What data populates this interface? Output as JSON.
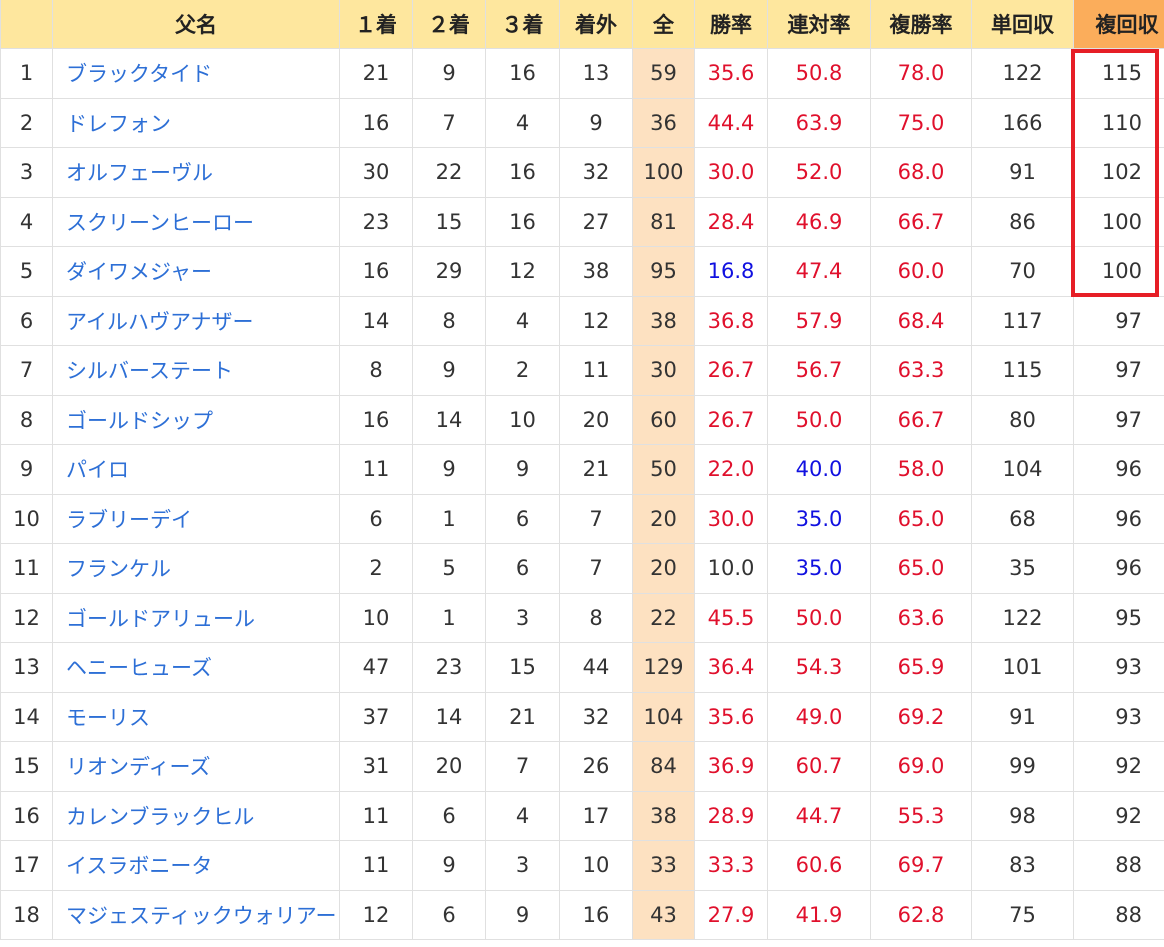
{
  "table": {
    "headers": {
      "rank": "",
      "name": "父名",
      "first": "１着",
      "second": "２着",
      "third": "３着",
      "out": "着外",
      "total": "全",
      "win_rate": "勝率",
      "quinella_rate": "連対率",
      "show_rate": "複勝率",
      "win_return": "単回収",
      "show_return": "複回収"
    },
    "rows": [
      {
        "rank": "1",
        "name": "ブラックタイド",
        "first": "21",
        "second": "9",
        "third": "16",
        "out": "13",
        "total": "59",
        "win_rate": "35.6",
        "quinella_rate": "50.8",
        "show_rate": "78.0",
        "win_return": "122",
        "show_return": "115"
      },
      {
        "rank": "2",
        "name": "ドレフォン",
        "first": "16",
        "second": "7",
        "third": "4",
        "out": "9",
        "total": "36",
        "win_rate": "44.4",
        "quinella_rate": "63.9",
        "show_rate": "75.0",
        "win_return": "166",
        "show_return": "110"
      },
      {
        "rank": "3",
        "name": "オルフェーヴル",
        "first": "30",
        "second": "22",
        "third": "16",
        "out": "32",
        "total": "100",
        "win_rate": "30.0",
        "quinella_rate": "52.0",
        "show_rate": "68.0",
        "win_return": "91",
        "show_return": "102"
      },
      {
        "rank": "4",
        "name": "スクリーンヒーロー",
        "first": "23",
        "second": "15",
        "third": "16",
        "out": "27",
        "total": "81",
        "win_rate": "28.4",
        "quinella_rate": "46.9",
        "show_rate": "66.7",
        "win_return": "86",
        "show_return": "100"
      },
      {
        "rank": "5",
        "name": "ダイワメジャー",
        "first": "16",
        "second": "29",
        "third": "12",
        "out": "38",
        "total": "95",
        "win_rate": "16.8",
        "quinella_rate": "47.4",
        "show_rate": "60.0",
        "win_return": "70",
        "show_return": "100"
      },
      {
        "rank": "6",
        "name": "アイルハヴアナザー",
        "first": "14",
        "second": "8",
        "third": "4",
        "out": "12",
        "total": "38",
        "win_rate": "36.8",
        "quinella_rate": "57.9",
        "show_rate": "68.4",
        "win_return": "117",
        "show_return": "97"
      },
      {
        "rank": "7",
        "name": "シルバーステート",
        "first": "8",
        "second": "9",
        "third": "2",
        "out": "11",
        "total": "30",
        "win_rate": "26.7",
        "quinella_rate": "56.7",
        "show_rate": "63.3",
        "win_return": "115",
        "show_return": "97"
      },
      {
        "rank": "8",
        "name": "ゴールドシップ",
        "first": "16",
        "second": "14",
        "third": "10",
        "out": "20",
        "total": "60",
        "win_rate": "26.7",
        "quinella_rate": "50.0",
        "show_rate": "66.7",
        "win_return": "80",
        "show_return": "97"
      },
      {
        "rank": "9",
        "name": "パイロ",
        "first": "11",
        "second": "9",
        "third": "9",
        "out": "21",
        "total": "50",
        "win_rate": "22.0",
        "quinella_rate": "40.0",
        "show_rate": "58.0",
        "win_return": "104",
        "show_return": "96"
      },
      {
        "rank": "10",
        "name": "ラブリーデイ",
        "first": "6",
        "second": "1",
        "third": "6",
        "out": "7",
        "total": "20",
        "win_rate": "30.0",
        "quinella_rate": "35.0",
        "show_rate": "65.0",
        "win_return": "68",
        "show_return": "96"
      },
      {
        "rank": "11",
        "name": "フランケル",
        "first": "2",
        "second": "5",
        "third": "6",
        "out": "7",
        "total": "20",
        "win_rate": "10.0",
        "quinella_rate": "35.0",
        "show_rate": "65.0",
        "win_return": "35",
        "show_return": "96"
      },
      {
        "rank": "12",
        "name": "ゴールドアリュール",
        "first": "10",
        "second": "1",
        "third": "3",
        "out": "8",
        "total": "22",
        "win_rate": "45.5",
        "quinella_rate": "50.0",
        "show_rate": "63.6",
        "win_return": "122",
        "show_return": "95"
      },
      {
        "rank": "13",
        "name": "ヘニーヒューズ",
        "first": "47",
        "second": "23",
        "third": "15",
        "out": "44",
        "total": "129",
        "win_rate": "36.4",
        "quinella_rate": "54.3",
        "show_rate": "65.9",
        "win_return": "101",
        "show_return": "93"
      },
      {
        "rank": "14",
        "name": "モーリス",
        "first": "37",
        "second": "14",
        "third": "21",
        "out": "32",
        "total": "104",
        "win_rate": "35.6",
        "quinella_rate": "49.0",
        "show_rate": "69.2",
        "win_return": "91",
        "show_return": "93"
      },
      {
        "rank": "15",
        "name": "リオンディーズ",
        "first": "31",
        "second": "20",
        "third": "7",
        "out": "26",
        "total": "84",
        "win_rate": "36.9",
        "quinella_rate": "60.7",
        "show_rate": "69.0",
        "win_return": "99",
        "show_return": "92"
      },
      {
        "rank": "16",
        "name": "カレンブラックヒル",
        "first": "11",
        "second": "6",
        "third": "4",
        "out": "17",
        "total": "38",
        "win_rate": "28.9",
        "quinella_rate": "44.7",
        "show_rate": "55.3",
        "win_return": "98",
        "show_return": "92"
      },
      {
        "rank": "17",
        "name": "イスラボニータ",
        "first": "11",
        "second": "9",
        "third": "3",
        "out": "10",
        "total": "33",
        "win_rate": "33.3",
        "quinella_rate": "60.6",
        "show_rate": "69.7",
        "win_return": "83",
        "show_return": "88"
      },
      {
        "rank": "18",
        "name": "マジェスティックウォリアー",
        "first": "12",
        "second": "6",
        "third": "9",
        "out": "16",
        "total": "43",
        "win_rate": "27.9",
        "quinella_rate": "41.9",
        "show_rate": "62.8",
        "win_return": "75",
        "show_return": "88"
      }
    ]
  },
  "colors": {
    "header_bg": "#fee79e",
    "sorted_header_bg": "#fbad5b",
    "total_col_bg": "#fde1c1",
    "link": "#2d6fd6",
    "rate_red": "#e0102c",
    "rate_blue": "#1010e0",
    "highlight": "#e61e26"
  }
}
